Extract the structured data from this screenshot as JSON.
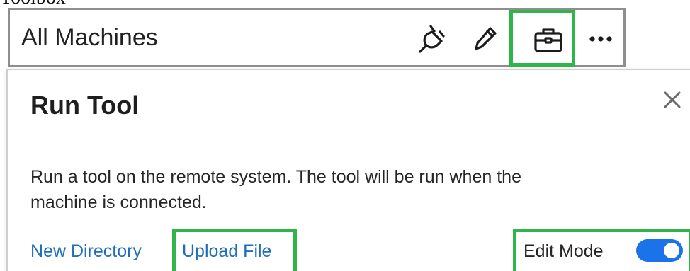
{
  "caption": "Toolbox",
  "header": {
    "title": "All Machines",
    "icons": [
      "plug-icon",
      "pencil-icon",
      "toolbox-icon",
      "more-icon"
    ]
  },
  "panel": {
    "title": "Run Tool",
    "description": "Run a tool on the remote system. The tool will be run when the\nmachine is connected.",
    "links": {
      "new_directory": "New Directory",
      "upload_file": "Upload File"
    },
    "edit_mode": {
      "label": "Edit Mode",
      "on": true
    }
  },
  "colors": {
    "highlight": "#2fb54a",
    "link": "#1f6fb8",
    "toggle": "#1a73e8",
    "border": "#8e8e8e"
  }
}
